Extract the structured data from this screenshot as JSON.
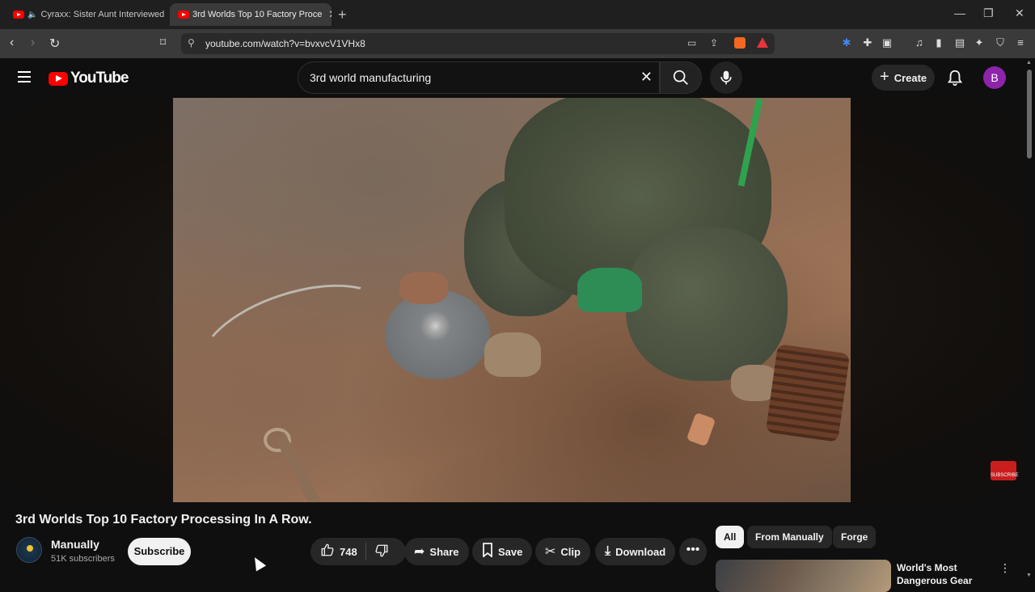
{
  "browser": {
    "tabs": [
      {
        "title": "Cyraxx: Sister Aunt Interviewed b",
        "active": false,
        "audio": true
      },
      {
        "title": "3rd Worlds Top 10 Factory Proce",
        "active": true
      }
    ],
    "url": "youtube.com/watch?v=bvxvcV1VHx8"
  },
  "youtube": {
    "logo_text": "YouTube",
    "search_query": "3rd world manufacturing",
    "create_label": "Create",
    "avatar_letter": "B"
  },
  "video": {
    "title": "3rd Worlds Top 10 Factory Processing In A Row.",
    "watermark": "SUBSCRIBE"
  },
  "channel": {
    "name": "Manually",
    "subscribers": "51K subscribers",
    "avatar_text": "MANUALLY",
    "subscribe_label": "Subscribe"
  },
  "actions": {
    "likes": "748",
    "share": "Share",
    "save": "Save",
    "clip": "Clip",
    "download": "Download"
  },
  "chips": [
    "All",
    "From Manually",
    "Forge"
  ],
  "recommended": [
    {
      "title": "World's Most Dangerous Gear"
    }
  ],
  "colors": {
    "brand": "#ff0000",
    "avatar": "#8e24aa",
    "background": "#0f0f0f"
  }
}
